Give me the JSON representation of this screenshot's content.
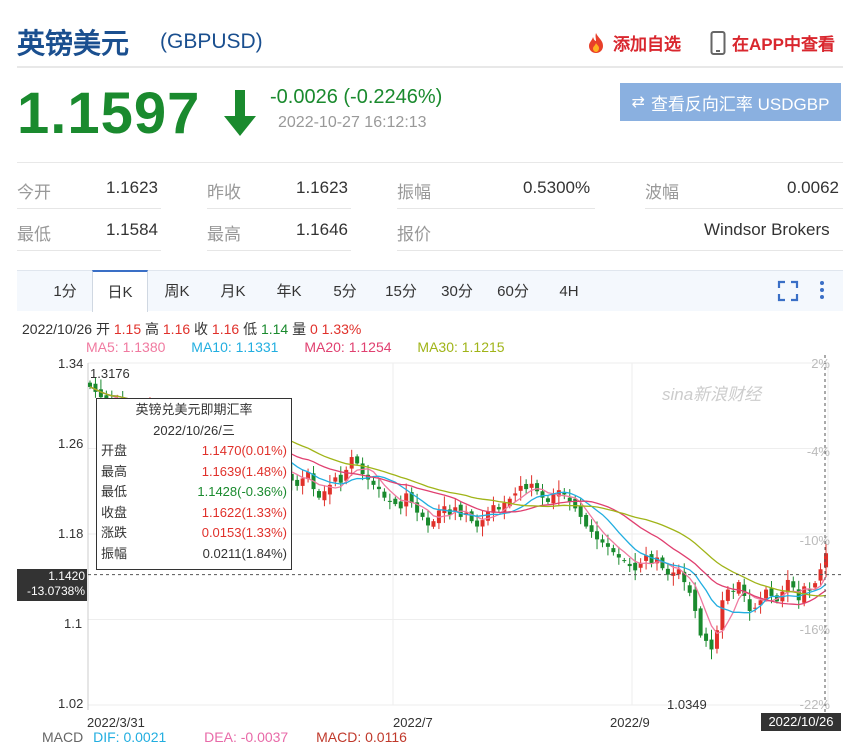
{
  "header": {
    "title": "英镑美元",
    "code": "(GBPUSD)",
    "add_watchlist": "添加自选",
    "view_in_app": "在APP中查看"
  },
  "quote": {
    "price": "1.1597",
    "change": "-0.0026 (-0.2246%)",
    "timestamp": "2022-10-27 16:12:13",
    "reverse_button": "查看反向汇率 USDGBP",
    "direction": "down",
    "down_color": "#1a8a2e"
  },
  "stats": {
    "open_label": "今开",
    "open_value": "1.1623",
    "prev_close_label": "昨收",
    "prev_close_value": "1.1623",
    "amplitude_label": "振幅",
    "amplitude_value": "0.5300%",
    "volatility_label": "波幅",
    "volatility_value": "0.0062",
    "low_label": "最低",
    "low_value": "1.1584",
    "high_label": "最高",
    "high_value": "1.1646",
    "quote_label": "报价",
    "quote_value": "Windsor Brokers"
  },
  "tabs": [
    "1分",
    "日K",
    "周K",
    "月K",
    "年K",
    "5分",
    "15分",
    "30分",
    "60分",
    "4H"
  ],
  "active_tab": "日K",
  "bar_info": {
    "date": "2022/10/26",
    "open_label": "开",
    "open": "1.15",
    "high_label": "高",
    "high": "1.16",
    "close_label": "收",
    "close": "1.16",
    "low_label": "低",
    "low": "1.14",
    "vol_label": "量",
    "vol": "0",
    "pct": "1.33%"
  },
  "ma": {
    "ma5": "MA5: 1.1380",
    "ma10": "MA10: 1.1331",
    "ma20": "MA20: 1.1254",
    "ma30": "MA30: 1.1215",
    "ma5_color": "#f07aa0",
    "ma10_color": "#22aee0",
    "ma20_color": "#e04070",
    "ma30_color": "#a0b418"
  },
  "tooltip": {
    "title": "英镑兑美元即期汇率",
    "date": "2022/10/26/三",
    "rows": [
      {
        "label": "开盘",
        "value": "1.1470(0.01%)",
        "color": "red"
      },
      {
        "label": "最高",
        "value": "1.1639(1.48%)",
        "color": "red"
      },
      {
        "label": "最低",
        "value": "1.1428(-0.36%)",
        "color": "green"
      },
      {
        "label": "收盘",
        "value": "1.1622(1.33%)",
        "color": "red"
      },
      {
        "label": "涨跌",
        "value": "0.0153(1.33%)",
        "color": "red"
      },
      {
        "label": "振幅",
        "value": "0.0211(1.84%)",
        "color": "dark"
      }
    ]
  },
  "axis": {
    "y_labels": [
      "1.34",
      "1.26",
      "1.18",
      "1.1",
      "1.02"
    ],
    "y_pct_labels": [
      "2%",
      "-4%",
      "-10%",
      "-16%",
      "-22%"
    ],
    "x_labels": [
      "2022/3/31",
      "2022/7",
      "2022/9"
    ],
    "x_current": "2022/10/26",
    "crosshair_price": "1.1420",
    "crosshair_pct": "-13.0738%",
    "max_label": "1.3176",
    "min_label": "1.0349",
    "watermark": "sina新浪财经"
  },
  "macd": {
    "label": "MACD",
    "dif": "DIF: 0.0021",
    "dea": "DEA: -0.0037",
    "macd": "MACD: 0.0116"
  },
  "chart_data": {
    "type": "candlestick",
    "ylim": [
      1.02,
      1.34
    ],
    "x_range": [
      "2022/3/31",
      "2022/10/26"
    ],
    "up_color": "#e0302a",
    "down_color": "#1a8a2e",
    "close_series": [
      1.3176,
      1.313,
      1.308,
      1.305,
      1.303,
      1.307,
      1.301,
      1.298,
      1.296,
      1.294,
      1.297,
      1.3,
      1.293,
      1.29,
      1.287,
      1.283,
      1.28,
      1.286,
      1.276,
      1.265,
      1.258,
      1.262,
      1.268,
      1.264,
      1.262,
      1.26,
      1.255,
      1.258,
      1.263,
      1.261,
      1.257,
      1.25,
      1.245,
      1.238,
      1.246,
      1.242,
      1.235,
      1.23,
      1.225,
      1.232,
      1.238,
      1.222,
      1.214,
      1.22,
      1.226,
      1.233,
      1.228,
      1.24,
      1.252,
      1.246,
      1.236,
      1.231,
      1.226,
      1.222,
      1.214,
      1.21,
      1.208,
      1.204,
      1.218,
      1.209,
      1.2,
      1.196,
      1.188,
      1.192,
      1.202,
      1.206,
      1.198,
      1.205,
      1.196,
      1.2,
      1.192,
      1.187,
      1.193,
      1.201,
      1.207,
      1.203,
      1.209,
      1.213,
      1.218,
      1.225,
      1.222,
      1.227,
      1.22,
      1.214,
      1.21,
      1.217,
      1.221,
      1.217,
      1.21,
      1.204,
      1.196,
      1.187,
      1.182,
      1.175,
      1.172,
      1.168,
      1.163,
      1.158,
      1.155,
      1.15,
      1.146,
      1.153,
      1.16,
      1.152,
      1.158,
      1.148,
      1.142,
      1.144,
      1.147,
      1.135,
      1.125,
      1.108,
      1.085,
      1.08,
      1.072,
      1.09,
      1.118,
      1.128,
      1.126,
      1.135,
      1.122,
      1.108,
      1.111,
      1.118,
      1.128,
      1.122,
      1.117,
      1.126,
      1.137,
      1.13,
      1.118,
      1.131,
      1.127,
      1.134,
      1.147,
      1.162
    ]
  }
}
